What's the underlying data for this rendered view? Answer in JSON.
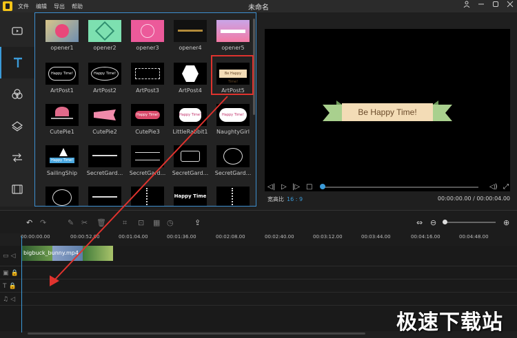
{
  "window": {
    "title": "未命名",
    "menu": [
      "文件",
      "编辑",
      "导出",
      "帮助"
    ],
    "controls": [
      "user-icon",
      "minimize-icon",
      "restore-icon",
      "close-icon"
    ]
  },
  "left_tools": [
    {
      "name": "media-icon"
    },
    {
      "name": "text-icon",
      "active": true
    },
    {
      "name": "filter-icon"
    },
    {
      "name": "overlay-icon"
    },
    {
      "name": "transition-icon"
    },
    {
      "name": "element-icon"
    }
  ],
  "templates": [
    {
      "label": "opener1"
    },
    {
      "label": "opener2"
    },
    {
      "label": "opener3"
    },
    {
      "label": "opener4"
    },
    {
      "label": "opener5"
    },
    {
      "label": "ArtPost1"
    },
    {
      "label": "ArtPost2"
    },
    {
      "label": "ArtPost3"
    },
    {
      "label": "ArtPost4"
    },
    {
      "label": "ArtPost5",
      "selected": true
    },
    {
      "label": "CutePie1"
    },
    {
      "label": "CutePie2"
    },
    {
      "label": "CutePie3"
    },
    {
      "label": "LittleRabbit1"
    },
    {
      "label": "NaughtyGirl"
    },
    {
      "label": "SailingShip"
    },
    {
      "label": "SecretGard..."
    },
    {
      "label": "SecretGard..."
    },
    {
      "label": "SecretGard..."
    },
    {
      "label": "SecretGard..."
    },
    {
      "label": ""
    },
    {
      "label": ""
    },
    {
      "label": ""
    },
    {
      "label": ""
    },
    {
      "label": ""
    }
  ],
  "thumb_texts": {
    "artpost1": "Happy Time!",
    "artpost2": "Happy Time!",
    "artpost5": "Be Happy Time!",
    "cutepie3": "Happy Time!",
    "rabbit": "Happy Time!",
    "naughty": "Happy Time!",
    "sailing": "Happy Time!",
    "row5_4": "Happy Time"
  },
  "preview": {
    "caption": "Be Happy Time!",
    "ratio_label": "宽高比",
    "ratio_value": "16 : 9",
    "timecode": "00:00:00.00 / 00:00:04.00",
    "progress": 0.0
  },
  "colors": {
    "accent": "#3b9bd9",
    "selection": "#e0332e",
    "ribbon": "#f3dcb6",
    "ribbon_side": "#a9d08e"
  },
  "timeline": {
    "ticks": [
      "00:00:00.00",
      "00:00:52.00",
      "00:01:04.00",
      "00:01:36.00",
      "00:02:08.00",
      "00:02:40.00",
      "00:03:12.00",
      "00:03:44.00",
      "00:04:16.00",
      "00:04:48.00"
    ],
    "clip_label": "bigbuck_bunny.mp4",
    "tracks": [
      "video-track",
      "pip-track",
      "text-track",
      "music-track"
    ]
  },
  "watermark": "极速下载站"
}
